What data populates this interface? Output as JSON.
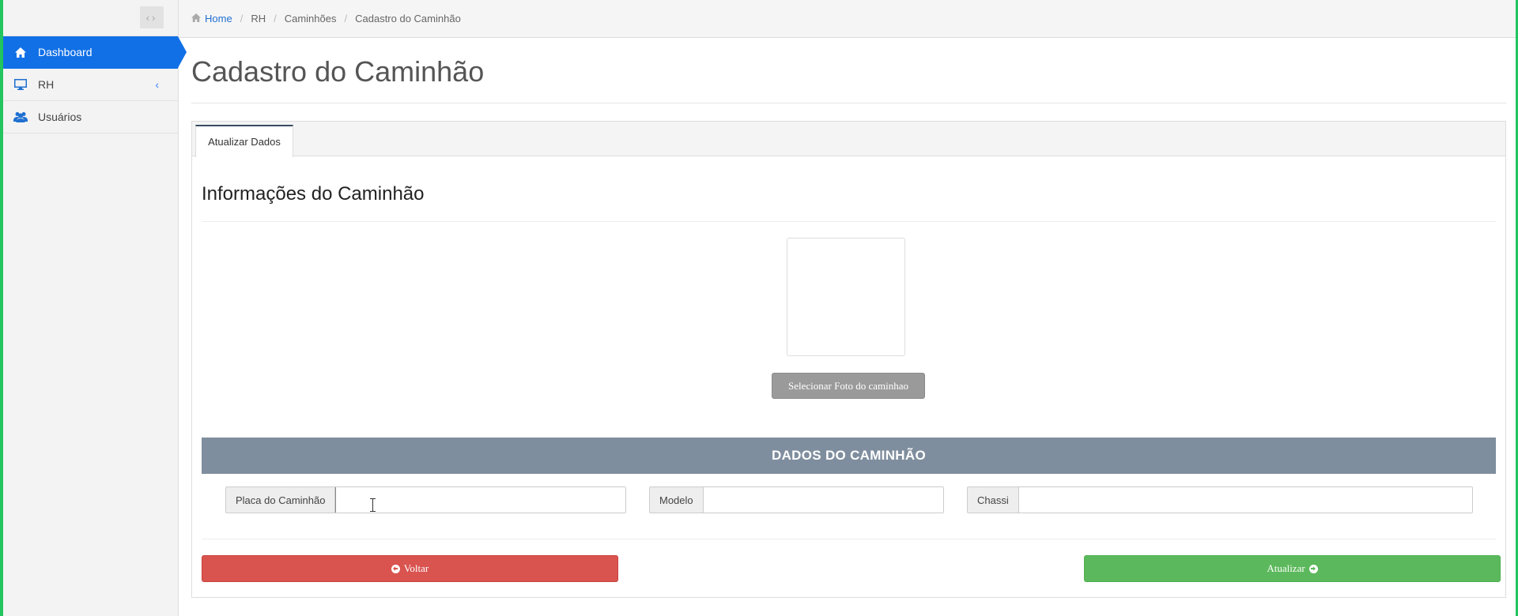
{
  "sidebar": {
    "toggle_icon": "chevrons-left-right-icon",
    "items": [
      {
        "label": "Dashboard",
        "icon": "home-icon",
        "active": true
      },
      {
        "label": "RH",
        "icon": "monitor-icon",
        "has_submenu": true
      },
      {
        "label": "Usuários",
        "icon": "users-icon"
      }
    ]
  },
  "breadcrumb": {
    "items": [
      "Home",
      "RH",
      "Caminhões",
      "Cadastro do Caminhão"
    ],
    "separator": "/"
  },
  "page": {
    "title": "Cadastro do Caminhão"
  },
  "tabs": [
    {
      "label": "Atualizar Dados",
      "active": true
    }
  ],
  "section": {
    "title": "Informações do Caminhão"
  },
  "photo": {
    "button_label": "Selecionar Foto do caminhao"
  },
  "dados": {
    "header": "DADOS DO CAMINHÃO",
    "fields": [
      {
        "label": "Placa do Caminhão",
        "value": ""
      },
      {
        "label": "Modelo",
        "value": ""
      },
      {
        "label": "Chassi",
        "value": ""
      }
    ]
  },
  "actions": {
    "voltar_label": "Voltar",
    "atualizar_label": "Atualizar"
  },
  "colors": {
    "frame": "#22c55e",
    "sidebar_active": "#1170e6",
    "header_bar": "#7f8e9e",
    "voltar": "#d9534f",
    "atualizar": "#5cb85c",
    "photo_button": "#9a9a9a"
  }
}
